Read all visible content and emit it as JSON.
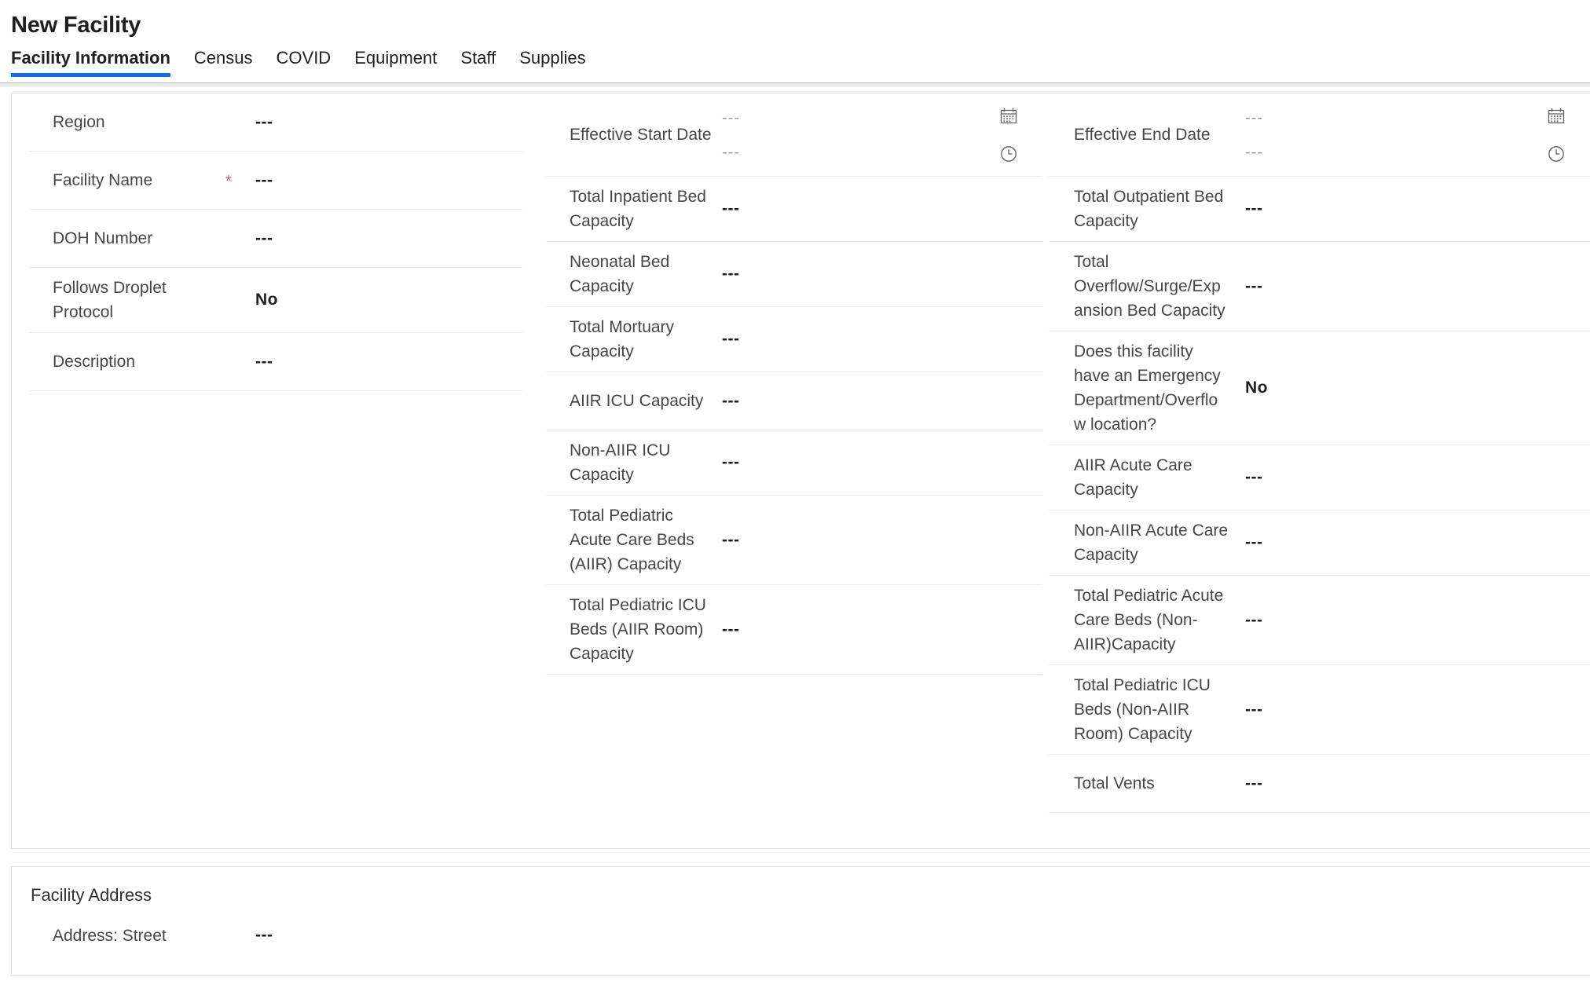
{
  "header": {
    "title": "New Facility"
  },
  "tabs": [
    {
      "label": "Facility Information",
      "active": true
    },
    {
      "label": "Census",
      "active": false
    },
    {
      "label": "COVID",
      "active": false
    },
    {
      "label": "Equipment",
      "active": false
    },
    {
      "label": "Staff",
      "active": false
    },
    {
      "label": "Supplies",
      "active": false
    }
  ],
  "placeholders": {
    "empty_value": "---",
    "required_marker": "*"
  },
  "colors": {
    "accent": "#0f6cf0",
    "required": "#e8505b",
    "label_text": "#484644",
    "value_text": "#201f1e",
    "divider": "#edebe9",
    "card_border": "#e1dfdd"
  },
  "facility_information": {
    "left_column": [
      {
        "label": "Region",
        "required": false,
        "value": "---"
      },
      {
        "label": "Facility Name",
        "required": true,
        "value": "---"
      },
      {
        "label": "DOH Number",
        "required": false,
        "value": "---"
      },
      {
        "label": "Follows Droplet Protocol",
        "required": false,
        "value": "No"
      },
      {
        "label": "Description",
        "required": false,
        "value": "---"
      }
    ],
    "middle_column": [
      {
        "label": "Effective Start Date",
        "type": "datetime",
        "date_value": "---",
        "time_value": "---",
        "date_icon": "calendar-icon",
        "time_icon": "clock-icon"
      },
      {
        "label": "Total Inpatient Bed Capacity",
        "required": false,
        "value": "---"
      },
      {
        "label": "Neonatal Bed Capacity",
        "required": false,
        "value": "---"
      },
      {
        "label": "Total Mortuary Capacity",
        "required": false,
        "value": "---"
      },
      {
        "label": "AIIR ICU Capacity",
        "required": false,
        "value": "---"
      },
      {
        "label": "Non-AIIR ICU Capacity",
        "required": false,
        "value": "---"
      },
      {
        "label": "Total Pediatric Acute Care Beds (AIIR) Capacity",
        "required": false,
        "value": "---"
      },
      {
        "label": "Total Pediatric ICU Beds (AIIR Room) Capacity",
        "required": false,
        "value": "---"
      }
    ],
    "right_column": [
      {
        "label": "Effective End Date",
        "type": "datetime",
        "date_value": "---",
        "time_value": "---",
        "date_icon": "calendar-icon",
        "time_icon": "clock-icon"
      },
      {
        "label": "Total Outpatient Bed Capacity",
        "required": false,
        "value": "---"
      },
      {
        "label": "Total Overflow/Surge/Expansion Bed Capacity",
        "required": false,
        "value": "---"
      },
      {
        "label": "Does this facility have an Emergency Department/Overflow location?",
        "required": false,
        "value": "No"
      },
      {
        "label": "AIIR Acute Care Capacity",
        "required": false,
        "value": "---"
      },
      {
        "label": "Non-AIIR Acute Care Capacity",
        "required": false,
        "value": "---"
      },
      {
        "label": "Total Pediatric Acute Care Beds (Non-AIIR)Capacity",
        "required": false,
        "value": "---"
      },
      {
        "label": "Total Pediatric ICU Beds (Non-AIIR Room) Capacity",
        "required": false,
        "value": "---"
      },
      {
        "label": "Total Vents",
        "required": false,
        "value": "---"
      }
    ]
  },
  "facility_address": {
    "section_title": "Facility Address",
    "fields": [
      {
        "label": "Address: Street",
        "required": false,
        "value": "---"
      }
    ]
  }
}
